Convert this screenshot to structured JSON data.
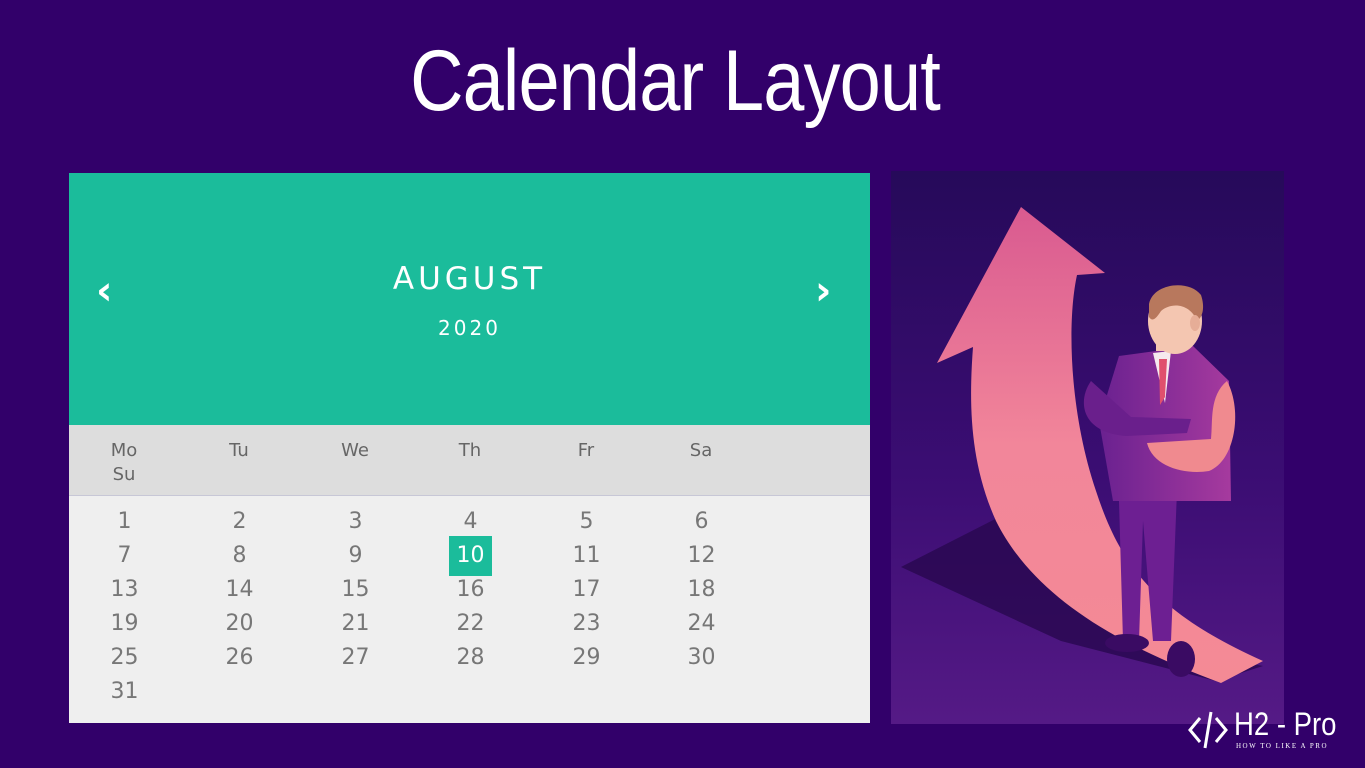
{
  "page": {
    "title": "Calendar Layout"
  },
  "calendar": {
    "month": "AUGUST",
    "year": "2020",
    "prev_icon": "chevron-left-icon",
    "next_icon": "chevron-right-icon",
    "prev_glyph": "‹",
    "next_glyph": "›",
    "weekdays": [
      "Mo",
      "Tu",
      "We",
      "Th",
      "Fr",
      "Sa",
      "Su"
    ],
    "days": [
      [
        "1",
        "2",
        "3",
        "4",
        "5",
        "6"
      ],
      [
        "7",
        "8",
        "9",
        "10",
        "11",
        "12"
      ],
      [
        "13",
        "14",
        "15",
        "16",
        "17",
        "18"
      ],
      [
        "19",
        "20",
        "21",
        "22",
        "23",
        "24"
      ],
      [
        "25",
        "26",
        "27",
        "28",
        "29",
        "30"
      ],
      [
        "31"
      ]
    ],
    "selected_day": "10",
    "header_color": "#1bbc9b",
    "body_color": "#efefef"
  },
  "logo": {
    "text": "H2 - Pro",
    "tagline": "HOW TO LIKE A PRO"
  },
  "colors": {
    "background": "#32006a",
    "accent": "#1bbc9b"
  }
}
